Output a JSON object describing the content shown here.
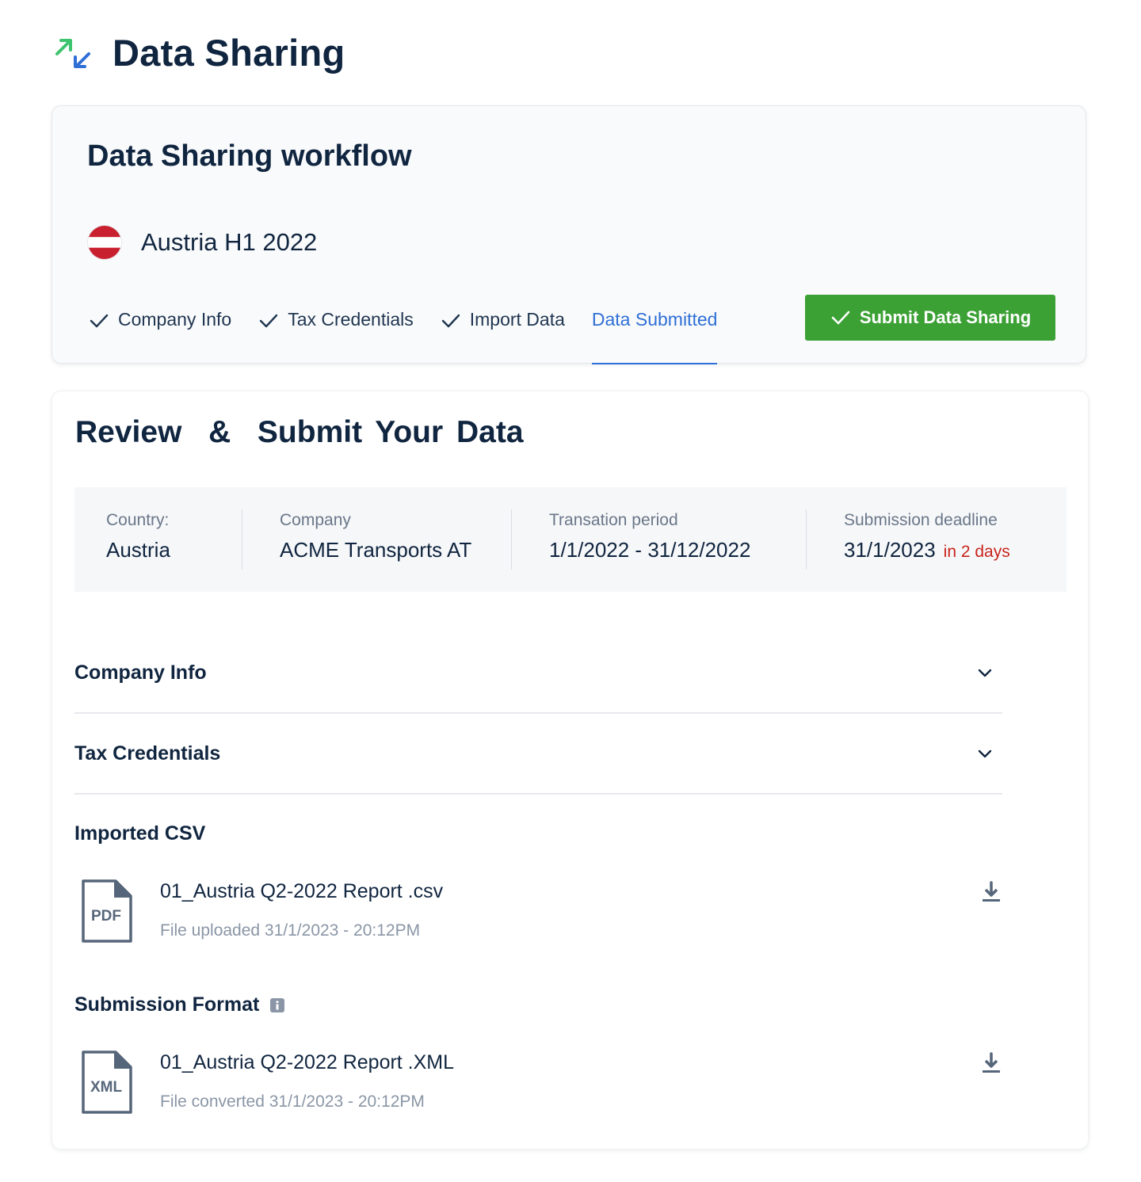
{
  "header": {
    "title": "Data Sharing",
    "logo_icon": "arrows-exchange-icon"
  },
  "workflow": {
    "title": "Data Sharing workflow",
    "report_name": "Austria H1 2022",
    "flag_icon": "austria-flag-icon",
    "steps": [
      {
        "label": "Company Info",
        "done": true
      },
      {
        "label": "Tax Credentials",
        "done": true
      },
      {
        "label": "Import Data",
        "done": true
      },
      {
        "label": "Data Submitted",
        "active": true
      }
    ],
    "submit_label": "Submit Data Sharing"
  },
  "review": {
    "title": "Review  &  Submit Your Data",
    "summary": {
      "country_label": "Country:",
      "country_value": "Austria",
      "company_label": "Company",
      "company_value": "ACME Transports AT",
      "period_label": "Transation period",
      "period_value": "1/1/2022 - 31/12/2022",
      "deadline_label": "Submission deadline",
      "deadline_value": "31/1/2023",
      "deadline_due": "in 2 days"
    },
    "accordions": [
      {
        "title": "Company Info"
      },
      {
        "title": "Tax Credentials"
      }
    ],
    "imported": {
      "title": "Imported CSV",
      "file_badge": "PDF",
      "file_name": "01_Austria Q2-2022 Report .csv",
      "file_meta": "File uploaded 31/1/2023 - 20:12PM"
    },
    "format": {
      "title": "Submission Format",
      "file_badge": "XML",
      "file_name": "01_Austria Q2-2022 Report .XML",
      "file_meta": "File converted 31/1/2023 - 20:12PM"
    }
  },
  "colors": {
    "primary_text": "#10253f",
    "accent_blue": "#2f6fd6",
    "success_green": "#3ca135",
    "danger_red": "#c8241c"
  }
}
